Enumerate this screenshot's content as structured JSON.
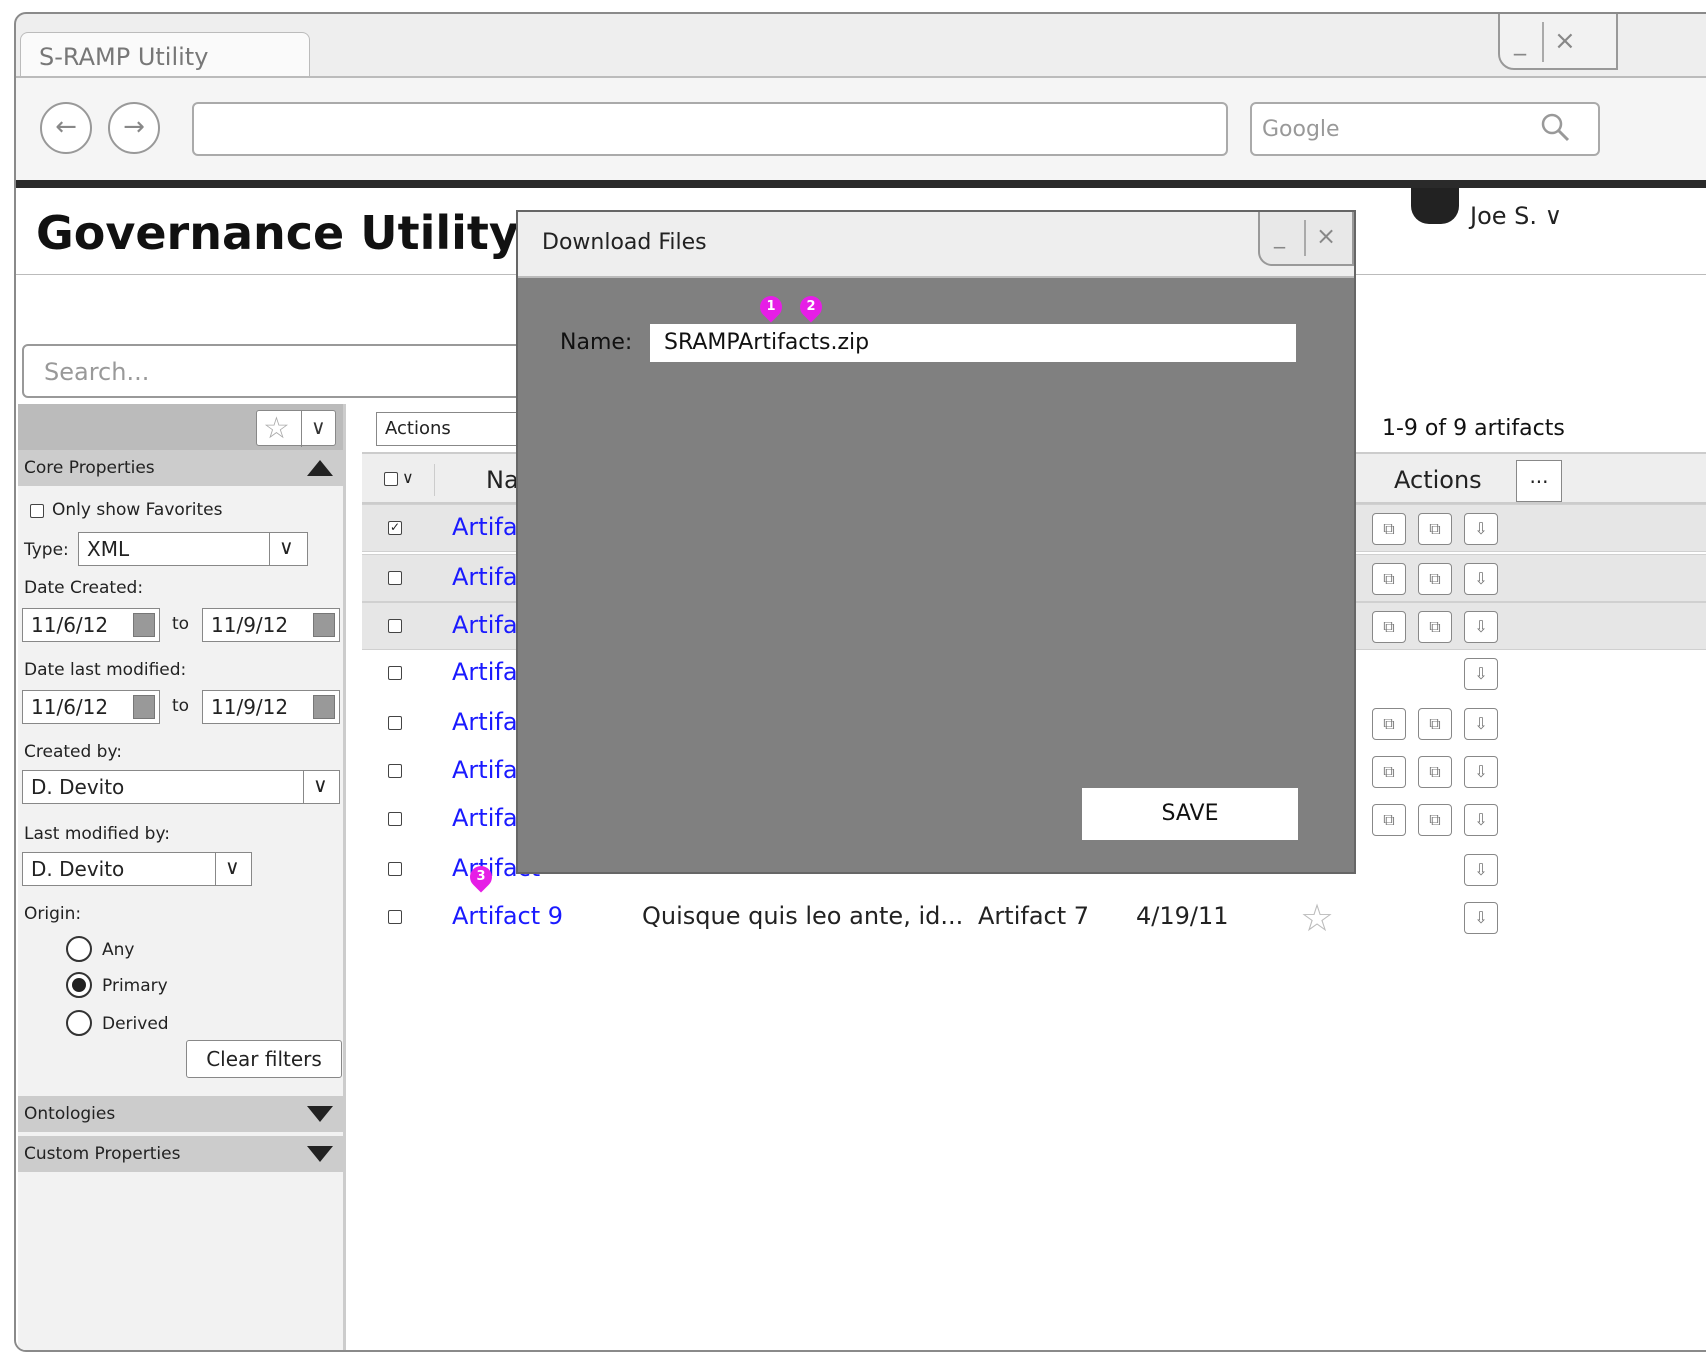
{
  "browser": {
    "tab_title": "S-RAMP Utility",
    "min_glyph": "_",
    "close_glyph": "×",
    "back_glyph": "←",
    "forward_glyph": "→",
    "url_value": "",
    "search_placeholder": "Google"
  },
  "app": {
    "title": "Governance Utility",
    "user": "Joe S.",
    "user_caret": "∨",
    "search_placeholder": "Search..."
  },
  "filters": {
    "star_glyph": "☆",
    "caret_glyph": "∨",
    "core_properties": "Core Properties",
    "only_favorites": "Only show Favorites",
    "type_label": "Type:",
    "type_value": "XML",
    "date_created_label": "Date Created:",
    "created_from": "11/6/12",
    "created_to": "11/9/12",
    "to_label": "to",
    "date_modified_label": "Date last modified:",
    "modified_from": "11/6/12",
    "modified_to": "11/9/12",
    "created_by_label": "Created by:",
    "created_by_value": "D. Devito",
    "modified_by_label": "Last modified by:",
    "modified_by_value": "D. Devito",
    "origin_label": "Origin:",
    "origin_options": [
      "Any",
      "Primary",
      "Derived"
    ],
    "origin_selected": "Primary",
    "clear_filters": "Clear filters",
    "ontologies": "Ontologies",
    "custom_properties": "Custom Properties"
  },
  "table": {
    "actions_dropdown": "Actions",
    "count_text": "1-9 of 9 artifacts",
    "header_checkbox_caret": "∨",
    "col_name": "Nam",
    "col_actions": "Actions",
    "more_button": "...",
    "rows": [
      {
        "name": "Artifact",
        "selected": true,
        "checked": true
      },
      {
        "name": "Artifact",
        "selected": true,
        "checked": false
      },
      {
        "name": "Artifact",
        "selected": true,
        "checked": false
      },
      {
        "name": "Artifact",
        "selected": false,
        "checked": false
      },
      {
        "name": "Artifact",
        "selected": false,
        "checked": false
      },
      {
        "name": "Artifact",
        "selected": false,
        "checked": false
      },
      {
        "name": "Artifact",
        "selected": false,
        "checked": false
      },
      {
        "name": "Artifact",
        "selected": false,
        "checked": false
      },
      {
        "name": "Artifact 9",
        "description": "Quisque quis leo ante, id...",
        "created_by": "Artifact 7",
        "date": "4/19/11",
        "selected": false,
        "checked": false
      }
    ],
    "checkmark_glyph": "✓",
    "star_glyph": "☆",
    "copy_icon_glyph": "⧉",
    "download_icon_glyph": "⇩"
  },
  "dialog": {
    "title": "Download Files",
    "min_glyph": "_",
    "close_glyph": "×",
    "name_label": "Name:",
    "name_value": "SRAMPArtifacts.zip",
    "save_button": "SAVE"
  },
  "annotations": [
    "1",
    "2",
    "3"
  ],
  "colors": {
    "link": "#1a1aff",
    "dialog_body": "#808080",
    "annotation_pin": "#e61ee6"
  }
}
